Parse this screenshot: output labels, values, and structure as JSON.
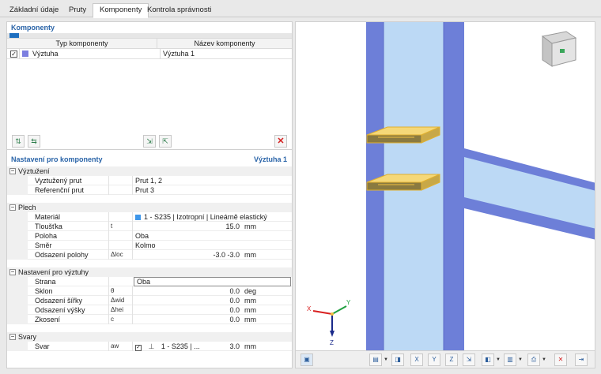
{
  "tabs": [
    "Základní údaje",
    "Pruty",
    "Komponenty",
    "Kontrola správnosti"
  ],
  "active_tab": 2,
  "components": {
    "title": "Komponenty",
    "col_type": "Typ komponenty",
    "col_name": "Název komponenty",
    "rows": [
      {
        "checked": "✓",
        "type": "Výztuha",
        "name": "Výztuha 1",
        "color": "#7c7fe0"
      }
    ]
  },
  "toolbar1": {
    "btn_a": "⇅",
    "btn_b": "⇆",
    "btn_c": "⇲",
    "btn_d": "⇱",
    "delete": "✕"
  },
  "settings": {
    "title": "Nastavení pro komponenty",
    "current": "Výztuha 1",
    "groups": {
      "vyztuzeni": {
        "label": "Výztužení",
        "toggle": "−",
        "rows": [
          {
            "k": "Vyztužený prut",
            "v": "Prut 1, 2"
          },
          {
            "k": "Referenční prut",
            "v": "Prut 3"
          }
        ]
      },
      "plech": {
        "label": "Plech",
        "toggle": "−",
        "material_key": "Materiál",
        "material_val": "1 - S235 | Izotropní | Lineárně elastický",
        "material_color": "#3f97ea",
        "tloustka": {
          "k": "Tloušťka",
          "sym": "t",
          "num": "15.0",
          "unit": "mm"
        },
        "poloha": {
          "k": "Poloha",
          "v": "Oba"
        },
        "smer": {
          "k": "Směr",
          "v": "Kolmo"
        },
        "odsazeni": {
          "k": "Odsazení polohy",
          "sym": "Δloc",
          "num": "-3.0 -3.0",
          "unit": "mm"
        }
      },
      "nastaveni": {
        "label": "Nastavení pro výztuhy",
        "toggle": "−",
        "strana": {
          "k": "Strana",
          "v": "Oba"
        },
        "sklon": {
          "k": "Sklon",
          "sym": "θ",
          "num": "0.0",
          "unit": "deg"
        },
        "sirka": {
          "k": "Odsazení šířky",
          "sym": "Δwid",
          "num": "0.0",
          "unit": "mm"
        },
        "vyska": {
          "k": "Odsazení výšky",
          "sym": "Δhei",
          "num": "0.0",
          "unit": "mm"
        },
        "zkoseni": {
          "k": "Zkosení",
          "sym": "c",
          "num": "0.0",
          "unit": "mm"
        }
      },
      "svary": {
        "label": "Svary",
        "toggle": "−",
        "svar": {
          "k": "Svar",
          "sym": "aw",
          "check": "✓",
          "weld_icon": "⊥",
          "mat": "1 - S235 | ...",
          "num": "3.0",
          "unit": "mm"
        }
      }
    }
  },
  "axes": {
    "x": "X",
    "y": "Y",
    "z": "Z"
  },
  "colors": {
    "accent": "#2a64a8",
    "member": "#6d7fd8",
    "member_light": "#bcd9f5",
    "plate": "#f0c040"
  }
}
